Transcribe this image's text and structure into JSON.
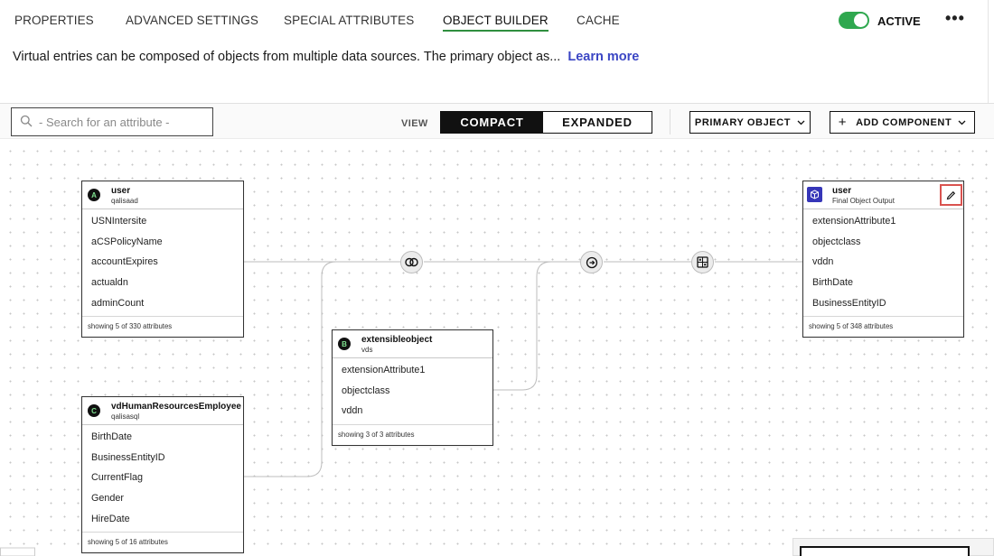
{
  "nav": {
    "tabs": [
      {
        "label": "PROPERTIES"
      },
      {
        "label": "ADVANCED SETTINGS"
      },
      {
        "label": "SPECIAL ATTRIBUTES"
      },
      {
        "label": "OBJECT BUILDER"
      },
      {
        "label": "CACHE"
      }
    ],
    "active_tab": "OBJECT BUILDER",
    "status_label": "ACTIVE",
    "status_on": true,
    "more_label": "•••"
  },
  "description": {
    "text": "Virtual entries can be composed of objects from multiple data sources. The primary object as...",
    "link": "Learn more"
  },
  "toolbar": {
    "search_placeholder": "- Search for an attribute -",
    "view_label": "VIEW",
    "view_options": [
      "COMPACT",
      "EXPANDED"
    ],
    "selected_view": "COMPACT",
    "primary_object_label": "PRIMARY OBJECT",
    "add_component_label": "ADD COMPONENT"
  },
  "cards": {
    "a": {
      "badge": "A",
      "title": "user",
      "subtitle": "qalisaad",
      "attributes": [
        "USNIntersite",
        "aCSPolicyName",
        "accountExpires",
        "actualdn",
        "adminCount"
      ],
      "footer": "showing 5 of 330 attributes"
    },
    "b": {
      "badge": "B",
      "title": "extensibleobject",
      "subtitle": "vds",
      "attributes": [
        "extensionAttribute1",
        "objectclass",
        "vddn"
      ],
      "footer": "showing 3 of 3 attributes"
    },
    "c": {
      "badge": "C",
      "title": "vdHumanResourcesEmployee",
      "subtitle": "qalisasql",
      "attributes": [
        "BirthDate",
        "BusinessEntityID",
        "CurrentFlag",
        "Gender",
        "HireDate"
      ],
      "footer": "showing 5 of 16 attributes"
    },
    "output": {
      "title": "user",
      "subtitle": "Final Object Output",
      "attributes": [
        "extensionAttribute1",
        "objectclass",
        "vddn",
        "BirthDate",
        "BusinessEntityID"
      ],
      "footer": "showing 5 of 348 attributes"
    }
  },
  "colors": {
    "accent_green": "#2fa84f",
    "link_blue": "#3b46c4",
    "output_badge": "#3636b8",
    "edit_highlight": "#d9534f"
  }
}
